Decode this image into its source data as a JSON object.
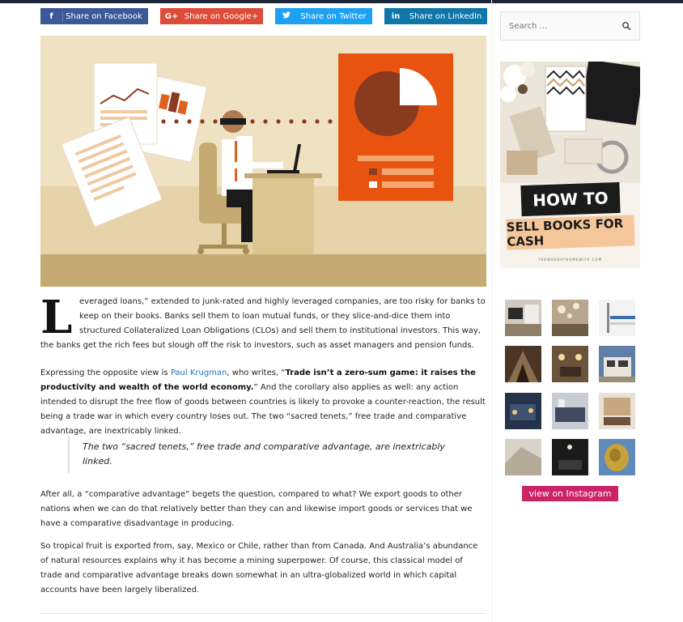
{
  "share": {
    "facebook": {
      "icon": "f",
      "label": "Share on Facebook"
    },
    "google": {
      "icon": "G+",
      "label": "Share on Google+"
    },
    "twitter": {
      "icon": "t",
      "label": "Share on Twitter"
    },
    "linkedin": {
      "icon": "in",
      "label": "Share on LinkedIn"
    }
  },
  "colors": {
    "facebook": "#3b5998",
    "google": "#dd4b39",
    "twitter": "#1da1f2",
    "linkedin": "#0e76a8",
    "instagram": "#cc2366",
    "link": "#1e73be"
  },
  "article": {
    "dropcap": "L",
    "p1": "everaged loans,” extended to junk-rated and highly leveraged companies, are too risky for banks to keep on their books. Banks sell them to loan mutual funds, or they slice-and-dice them into structured Collateralized Loan Obligations (CLOs) and sell them to institutional investors. This way, the banks get the rich fees but slough off the risk to investors, such as asset managers and pension funds.",
    "p2_pre": "Expressing the opposite view is ",
    "p2_link": "Paul Krugman",
    "p2_mid": ", who writes, “",
    "p2_bold": "Trade isn’t a zero-sum game: it raises the productivity and wealth of the world economy.",
    "p2_post": "” And the corollary also applies as well: any action intended to disrupt the free flow of goods between countries is likely to provoke a counter-reaction, the result being a trade war in which every country loses out. The two “sacred tenets,” free trade and comparative advantage, are inextricably linked.",
    "quote": "The two “sacred tenets,” free trade and comparative advantage, are inextricably linked.",
    "p3": "After all, a “comparative advantage” begets the question, compared to what? We export goods to other nations when we can do that relatively better than they can and likewise import goods or services that we have a comparative disadvantage in producing.",
    "p4": "So tropical fruit is exported from, say, Mexico or Chile, rather than from Canada. And Australia’s abundance of natural resources explains why it has become a mining superpower. Of course, this classical model of trade and comparative advantage breaks down somewhat in an ultra-globalized world in which capital accounts have been largely liberalized."
  },
  "sidebar": {
    "search_placeholder": "Search ...",
    "search_icon": "search-icon",
    "ad": {
      "line1": "HOW TO",
      "line2": "SELL BOOKS FOR CASH",
      "credit": "THEWORKATHOMEWIFE.COM"
    },
    "instagram_button": "view on Instagram"
  }
}
